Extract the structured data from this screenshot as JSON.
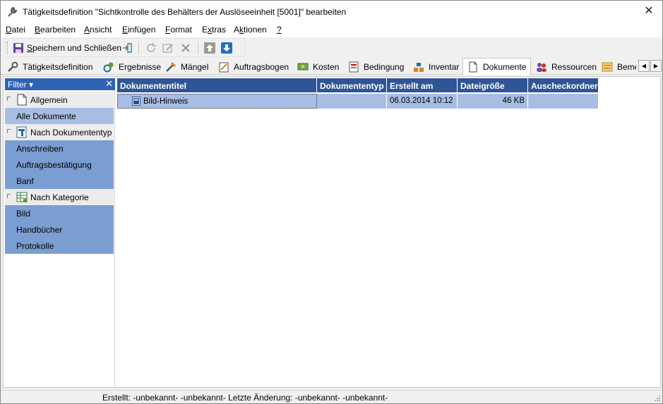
{
  "window": {
    "title": "Tätigkeitsdefinition \"Sichtkontrolle des Behälters der Auslöseeinheit [5001]\" bearbeiten",
    "close_symbol": "✕"
  },
  "menu": [
    {
      "pre": "",
      "u": "D",
      "post": "atei"
    },
    {
      "pre": "",
      "u": "B",
      "post": "earbeiten"
    },
    {
      "pre": "",
      "u": "A",
      "post": "nsicht"
    },
    {
      "pre": "",
      "u": "E",
      "post": "infügen"
    },
    {
      "pre": "",
      "u": "F",
      "post": "ormat"
    },
    {
      "pre": "E",
      "u": "x",
      "post": "tras"
    },
    {
      "pre": "A",
      "u": "k",
      "post": "tionen"
    },
    {
      "pre": "",
      "u": "?",
      "post": ""
    }
  ],
  "toolbar": {
    "save_label_pre": "",
    "save_label_u": "S",
    "save_label_post": "peichern und Schließen"
  },
  "tabs": [
    {
      "label": "Tätigkeitsdefinition",
      "icon": "wrench-icon"
    },
    {
      "label": "Ergebnisse",
      "icon": "results-icon"
    },
    {
      "label": "Mängel",
      "icon": "defects-icon"
    },
    {
      "label": "Auftragsbogen",
      "icon": "order-sheet-icon"
    },
    {
      "label": "Kosten",
      "icon": "costs-icon"
    },
    {
      "label": "Bedingung",
      "icon": "condition-icon"
    },
    {
      "label": "Inventar",
      "icon": "inventory-icon"
    },
    {
      "label": "Dokumente",
      "icon": "document-icon",
      "active": true
    },
    {
      "label": "Ressourcen",
      "icon": "resources-icon"
    },
    {
      "label": "Beme",
      "icon": "notes-icon"
    }
  ],
  "filter": {
    "header": "Filter ▾",
    "close": "✕",
    "groups": [
      {
        "label": "Allgemein",
        "items": [
          "Alle Dokumente"
        ]
      },
      {
        "label": "Nach Dokumententyp",
        "items": [
          "Anschreiben",
          "Auftragsbestätigung",
          "Banf"
        ]
      },
      {
        "label": "Nach Kategorie",
        "items": [
          "Bild",
          "Handbücher",
          "Protokolle"
        ]
      }
    ]
  },
  "grid": {
    "columns": [
      "Dokumententitel",
      "Dokumententyp",
      "Erstellt am",
      "Dateigröße",
      "Auscheckordner"
    ],
    "rows": [
      {
        "title": "Bild-Hinweis",
        "type": "",
        "created": "06.03.2014 10:12",
        "size": "46 KB",
        "checkout": ""
      }
    ]
  },
  "status": {
    "text": "Erstellt: -unbekannt- -unbekannt-  Letzte Änderung: -unbekannt- -unbekannt-"
  },
  "colors": {
    "accent": "#2f5597",
    "filter_header": "#2f63b3",
    "filter_item": "#7b9ed2",
    "selection": "#a8bde3"
  }
}
